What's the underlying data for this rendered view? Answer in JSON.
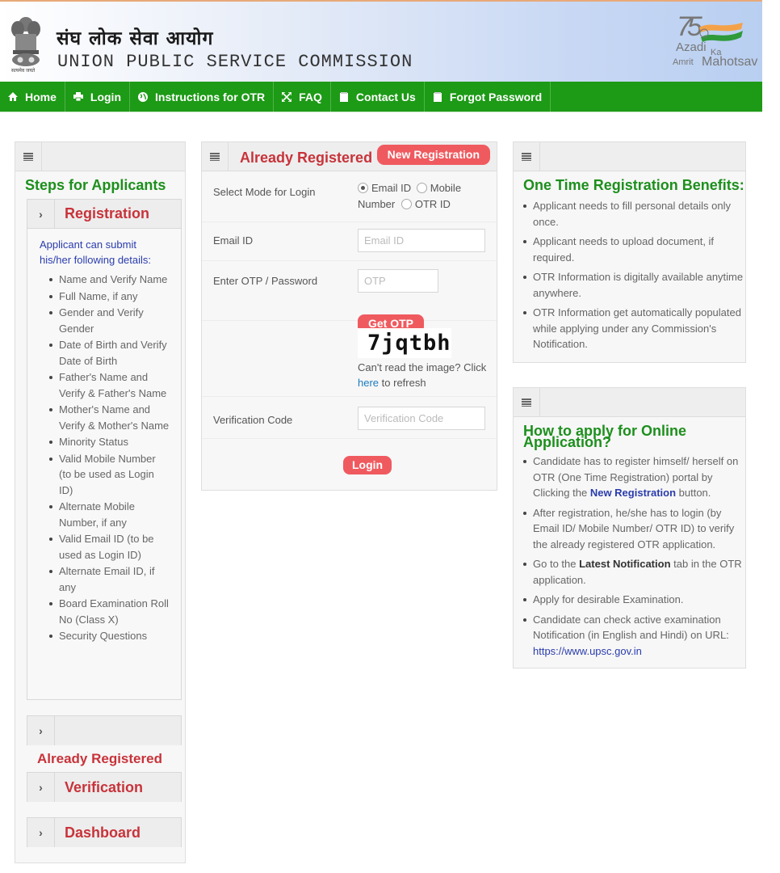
{
  "header": {
    "hindi_title": "संघ लोक सेवा आयोग",
    "english_title": "UNION PUBLIC SERVICE COMMISSION",
    "emblem_caption": "सत्यमेव जयते",
    "azadi_logo": {
      "number": "75",
      "line1": "Azadi",
      "ka": "Ka",
      "line2_a": "Amrit",
      "line2_b": "Mahotsav"
    }
  },
  "nav": {
    "items": [
      {
        "label": "Home",
        "icon": "home-icon"
      },
      {
        "label": "Login",
        "icon": "printer-icon"
      },
      {
        "label": "Instructions for OTR",
        "icon": "globe-icon"
      },
      {
        "label": "FAQ",
        "icon": "expand-icon"
      },
      {
        "label": "Contact Us",
        "icon": "document-icon"
      },
      {
        "label": "Forgot Password",
        "icon": "document-icon"
      }
    ]
  },
  "left_panel": {
    "title": "Steps for Applicants",
    "registration": {
      "title": "Registration",
      "intro": "Applicant can submit his/her following details:",
      "items": [
        "Name and Verify Name",
        "Full Name, if any",
        "Gender and Verify Gender",
        "Date of Birth and Verify Date of Birth",
        "Father's Name and Verify & Father's Name",
        "Mother's Name and Verify & Mother's Name",
        "Minority Status",
        "Valid Mobile Number (to be used as Login ID)",
        "Alternate Mobile Number, if any",
        "Valid Email ID (to be used as Login ID)",
        "Alternate Email ID, if any",
        "Board Examination Roll No (Class X)",
        "Security Questions"
      ]
    },
    "already_registered_label": "Already Registered",
    "verification_title": "Verification",
    "dashboard_title": "Dashboard"
  },
  "login_panel": {
    "title": "Already Registered",
    "new_registration_button": "New Registration",
    "mode_label": "Select Mode for Login",
    "mode_options": [
      {
        "label": "Email ID",
        "checked": true
      },
      {
        "label": "Mobile Number",
        "checked": false
      },
      {
        "label": "OTR ID",
        "checked": false
      }
    ],
    "email_label": "Email ID",
    "email_placeholder": "Email ID",
    "otp_label": "Enter OTP / Password",
    "otp_placeholder": "OTP",
    "get_otp_button": "Get OTP",
    "captcha_text": "7jqtbh",
    "captcha_help_prefix": "Can't read the image? Click",
    "captcha_help_link": "here",
    "captcha_help_suffix": "to refresh",
    "verification_label": "Verification Code",
    "verification_placeholder": "Verification Code",
    "login_button": "Login"
  },
  "benefits_panel": {
    "title": "One Time Registration Benefits:",
    "items": [
      "Applicant needs to fill personal details only once.",
      "Applicant needs to upload document, if required.",
      "OTR Information is digitally available anytime anywhere.",
      "OTR Information get automatically populated while applying under any Commission's Notification."
    ]
  },
  "howto_panel": {
    "title": "How to apply for Online Application?",
    "item1_prefix": "Candidate has to register himself/ herself on OTR (One Time Registration) portal by Clicking the",
    "item1_bold": "New Registration",
    "item1_suffix": "button.",
    "item2": "After registration, he/she has to login (by Email ID/ Mobile Number/ OTR ID) to verify the already registered OTR application.",
    "item3_prefix": "Go to the",
    "item3_bold": "Latest Notification",
    "item3_suffix": "tab in the OTR application.",
    "item4": "Apply for desirable Examination.",
    "item5_prefix": "Candidate can check active examination Notification (in English and Hindi) on URL:",
    "item5_link": "https://www.upsc.gov.in"
  },
  "colors": {
    "nav_green": "#1d9a16",
    "heading_green": "#1d8f1d",
    "accent_red": "#c8333a",
    "button_red": "#ef5a5f",
    "link_blue": "#2a3cad"
  }
}
